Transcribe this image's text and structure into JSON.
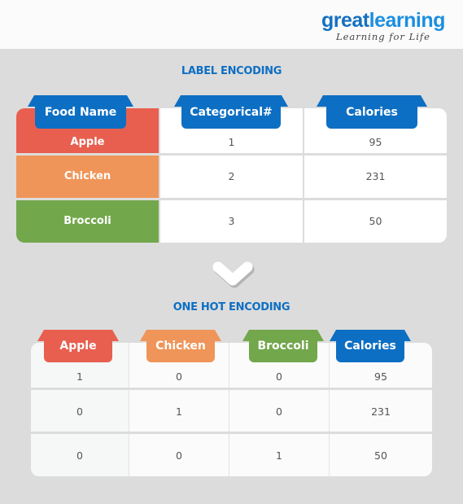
{
  "brand": {
    "name_part1": "great",
    "name_part2": "learning",
    "tagline": "Learning for Life"
  },
  "colors": {
    "blue": "#0d6fc3",
    "red": "#e85f4f",
    "orange": "#ef9559",
    "green": "#72a74c",
    "background": "#dcdcdc"
  },
  "label_encoding": {
    "title": "LABEL ENCODING",
    "headers": [
      "Food Name",
      "Categorical#",
      "Calories"
    ],
    "rows": [
      {
        "food": "Apple",
        "categorical": "1",
        "calories": "95"
      },
      {
        "food": "Chicken",
        "categorical": "2",
        "calories": "231"
      },
      {
        "food": "Broccoli",
        "categorical": "3",
        "calories": "50"
      }
    ]
  },
  "arrow": {
    "icon": "chevron-down-icon"
  },
  "one_hot_encoding": {
    "title": "ONE HOT ENCODING",
    "headers": [
      "Apple",
      "Chicken",
      "Broccoli",
      "Calories"
    ],
    "rows": [
      [
        "1",
        "0",
        "0",
        "95"
      ],
      [
        "0",
        "1",
        "0",
        "231"
      ],
      [
        "0",
        "0",
        "1",
        "50"
      ]
    ]
  }
}
